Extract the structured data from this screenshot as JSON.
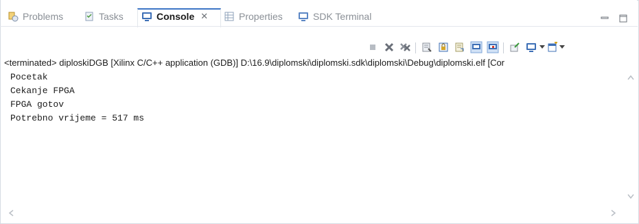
{
  "tabs": [
    {
      "label": "Problems",
      "icon": "problems-icon",
      "active": false
    },
    {
      "label": "Tasks",
      "icon": "tasks-icon",
      "active": false
    },
    {
      "label": "Console",
      "icon": "console-icon",
      "active": true,
      "close": "✕"
    },
    {
      "label": "Properties",
      "icon": "properties-icon",
      "active": false
    },
    {
      "label": "SDK Terminal",
      "icon": "terminal-icon",
      "active": false
    }
  ],
  "status_line": "<terminated> diploskiDGB [Xilinx C/C++ application (GDB)] D:\\16.9\\diplomski\\diplomski.sdk\\diplomski\\Debug\\diplomski.elf [Cor",
  "console_lines": [
    "Pocetak",
    "Cekanje FPGA",
    "FPGA gotov",
    "Potrebno vrijeme = 517 ms"
  ],
  "colors": {
    "active_tab_border": "#3c75c5",
    "console_icon": "#3d6fb6"
  }
}
